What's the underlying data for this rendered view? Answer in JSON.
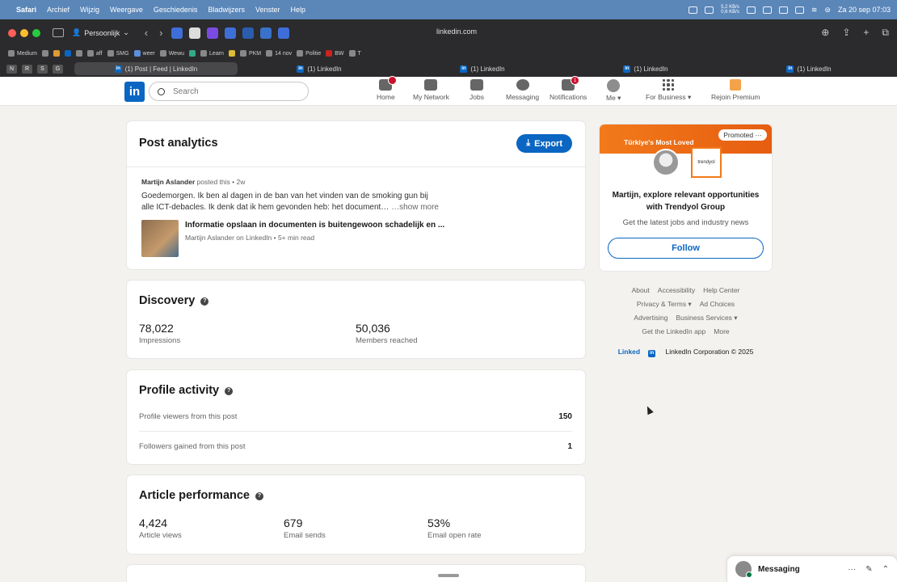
{
  "menubar": {
    "app": "Safari",
    "items": [
      "Archief",
      "Wijzig",
      "Weergave",
      "Geschiedenis",
      "Bladwijzers",
      "Venster",
      "Help"
    ],
    "net_up": "5,2 KB/s",
    "net_down": "0,6 KB/s",
    "clock": "Za 20 sep  07:03"
  },
  "browser": {
    "profile": "Persoonlijk",
    "url": "linkedin.com",
    "favorites": [
      "Medium",
      "aff",
      "SMG",
      "weer",
      "Wewu",
      "Learn",
      "PKM",
      "14 nov",
      "Politie",
      "BW",
      "T"
    ],
    "pinned": [
      "N",
      "R",
      "S",
      "G"
    ],
    "tabs": [
      "(1) Post | Feed | LinkedIn",
      "(1) LinkedIn",
      "(1) LinkedIn",
      "(1) LinkedIn",
      "(1) LinkedIn"
    ]
  },
  "linkedin": {
    "logo": "in",
    "search_placeholder": "Search",
    "nav": {
      "home": "Home",
      "network": "My Network",
      "jobs": "Jobs",
      "messaging": "Messaging",
      "notifications": "Notifications",
      "notifications_badge": "1",
      "me": "Me",
      "business": "For Business",
      "premium": "Rejoin Premium"
    }
  },
  "analytics": {
    "title": "Post analytics",
    "export_label": "Export",
    "post": {
      "author": "Martijn Aslander",
      "posted": "posted this • 2w",
      "text_line1": "Goedemorgen. Ik ben al dagen in de ban van het vinden van de smoking gun bij",
      "text_line2": "alle ICT-debacles. Ik denk dat ik hem gevonden heb: het document…",
      "show_more": "…show more",
      "article_title": "Informatie opslaan in documenten is buitengewoon schadelijk en ...",
      "article_meta": "Martijn Aslander on LinkedIn • 5+ min read"
    },
    "discovery": {
      "title": "Discovery",
      "impressions_value": "78,022",
      "impressions_label": "Impressions",
      "members_value": "50,036",
      "members_label": "Members reached"
    },
    "profile_activity": {
      "title": "Profile activity",
      "viewers_label": "Profile viewers from this post",
      "viewers_value": "150",
      "followers_label": "Followers gained from this post",
      "followers_value": "1"
    },
    "article_performance": {
      "title": "Article performance",
      "views_value": "4,424",
      "views_label": "Article views",
      "sends_value": "679",
      "sends_label": "Email sends",
      "open_value": "53%",
      "open_label": "Email open rate"
    }
  },
  "ad": {
    "promoted": "Promoted",
    "banner_text": "Türkiye's Most Loved",
    "brand": "trendyol",
    "headline": "Martijn, explore relevant opportunities with Trendyol Group",
    "sub": "Get the latest jobs and industry news",
    "follow_label": "Follow"
  },
  "footer": {
    "links": [
      "About",
      "Accessibility",
      "Help Center",
      "Privacy & Terms ▾",
      "Ad Choices",
      "Advertising",
      "Business Services ▾",
      "Get the LinkedIn app",
      "More"
    ],
    "brand_logo": "Linked",
    "copyright": "LinkedIn Corporation © 2025"
  },
  "messaging_dock": {
    "label": "Messaging"
  },
  "colors": {
    "linkedin_blue": "#0a66c2",
    "badge_red": "#cb112d",
    "menubar_blue": "#5a86b8"
  }
}
